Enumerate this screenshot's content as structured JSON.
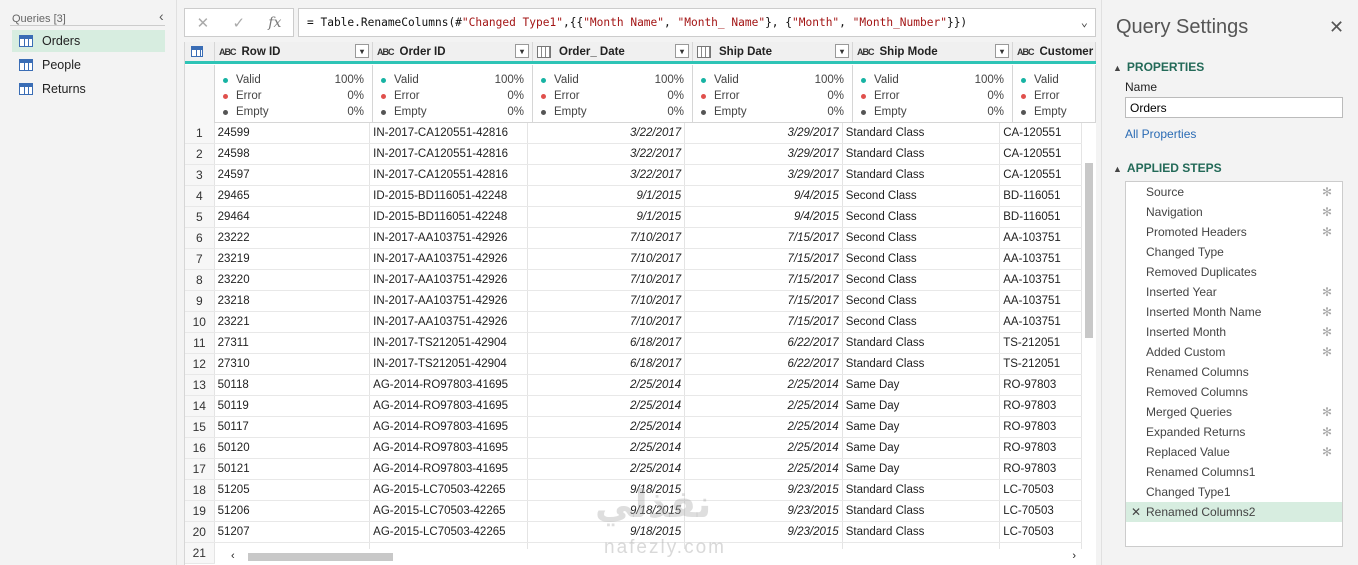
{
  "queries": {
    "header": "Queries [3]",
    "collapse_icon": "chevron-left-icon",
    "items": [
      {
        "label": "Orders",
        "selected": true
      },
      {
        "label": "People",
        "selected": false
      },
      {
        "label": "Returns",
        "selected": false
      }
    ]
  },
  "formula_bar": {
    "cancel_icon": "close-icon",
    "commit_icon": "check-icon",
    "fx_label": "fx",
    "formula": "= Table.RenameColumns(#\"Changed Type1\",{{\"Month Name\", \"Month_ Name\"}, {\"Month\", \"Month_Number\"}})",
    "formula_prefix": "= Table.RenameColumns(#",
    "formula_s1": "\"Changed Type1\"",
    "formula_p2": ",{{",
    "formula_s2": "\"Month Name\"",
    "formula_p3": ", ",
    "formula_s3": "\"Month_ Name\"",
    "formula_p4": "}, {",
    "formula_s4": "\"Month\"",
    "formula_p5": ", ",
    "formula_s5": "\"Month_Number\"",
    "formula_p6": "}})"
  },
  "grid": {
    "accent_color": "#2ec4b6",
    "columns": [
      {
        "name": "Row ID",
        "type": "text"
      },
      {
        "name": "Order ID",
        "type": "text"
      },
      {
        "name": "Order_ Date",
        "type": "date"
      },
      {
        "name": "Ship Date",
        "type": "date"
      },
      {
        "name": "Ship Mode",
        "type": "text"
      },
      {
        "name": "Customer ID",
        "type": "text"
      }
    ],
    "type_icon_text": "ABC",
    "quality_labels": {
      "valid": "Valid",
      "error": "Error",
      "empty": "Empty"
    },
    "quality": [
      {
        "valid": "100%",
        "error": "0%",
        "empty": "0%"
      },
      {
        "valid": "100%",
        "error": "0%",
        "empty": "0%"
      },
      {
        "valid": "100%",
        "error": "0%",
        "empty": "0%"
      },
      {
        "valid": "100%",
        "error": "0%",
        "empty": "0%"
      },
      {
        "valid": "100%",
        "error": "0%",
        "empty": "0%"
      },
      {
        "valid": "",
        "error": "",
        "empty": ""
      }
    ],
    "rows": [
      [
        "1",
        "24599",
        "IN-2017-CA120551-42816",
        "3/22/2017",
        "3/29/2017",
        "Standard Class",
        "CA-120551"
      ],
      [
        "2",
        "24598",
        "IN-2017-CA120551-42816",
        "3/22/2017",
        "3/29/2017",
        "Standard Class",
        "CA-120551"
      ],
      [
        "3",
        "24597",
        "IN-2017-CA120551-42816",
        "3/22/2017",
        "3/29/2017",
        "Standard Class",
        "CA-120551"
      ],
      [
        "4",
        "29465",
        "ID-2015-BD116051-42248",
        "9/1/2015",
        "9/4/2015",
        "Second Class",
        "BD-116051"
      ],
      [
        "5",
        "29464",
        "ID-2015-BD116051-42248",
        "9/1/2015",
        "9/4/2015",
        "Second Class",
        "BD-116051"
      ],
      [
        "6",
        "23222",
        "IN-2017-AA103751-42926",
        "7/10/2017",
        "7/15/2017",
        "Second Class",
        "AA-103751"
      ],
      [
        "7",
        "23219",
        "IN-2017-AA103751-42926",
        "7/10/2017",
        "7/15/2017",
        "Second Class",
        "AA-103751"
      ],
      [
        "8",
        "23220",
        "IN-2017-AA103751-42926",
        "7/10/2017",
        "7/15/2017",
        "Second Class",
        "AA-103751"
      ],
      [
        "9",
        "23218",
        "IN-2017-AA103751-42926",
        "7/10/2017",
        "7/15/2017",
        "Second Class",
        "AA-103751"
      ],
      [
        "10",
        "23221",
        "IN-2017-AA103751-42926",
        "7/10/2017",
        "7/15/2017",
        "Second Class",
        "AA-103751"
      ],
      [
        "11",
        "27311",
        "IN-2017-TS212051-42904",
        "6/18/2017",
        "6/22/2017",
        "Standard Class",
        "TS-212051"
      ],
      [
        "12",
        "27310",
        "IN-2017-TS212051-42904",
        "6/18/2017",
        "6/22/2017",
        "Standard Class",
        "TS-212051"
      ],
      [
        "13",
        "50118",
        "AG-2014-RO97803-41695",
        "2/25/2014",
        "2/25/2014",
        "Same Day",
        "RO-97803"
      ],
      [
        "14",
        "50119",
        "AG-2014-RO97803-41695",
        "2/25/2014",
        "2/25/2014",
        "Same Day",
        "RO-97803"
      ],
      [
        "15",
        "50117",
        "AG-2014-RO97803-41695",
        "2/25/2014",
        "2/25/2014",
        "Same Day",
        "RO-97803"
      ],
      [
        "16",
        "50120",
        "AG-2014-RO97803-41695",
        "2/25/2014",
        "2/25/2014",
        "Same Day",
        "RO-97803"
      ],
      [
        "17",
        "50121",
        "AG-2014-RO97803-41695",
        "2/25/2014",
        "2/25/2014",
        "Same Day",
        "RO-97803"
      ],
      [
        "18",
        "51205",
        "AG-2015-LC70503-42265",
        "9/18/2015",
        "9/23/2015",
        "Standard Class",
        "LC-70503"
      ],
      [
        "19",
        "51206",
        "AG-2015-LC70503-42265",
        "9/18/2015",
        "9/23/2015",
        "Standard Class",
        "LC-70503"
      ],
      [
        "20",
        "51207",
        "AG-2015-LC70503-42265",
        "9/18/2015",
        "9/23/2015",
        "Standard Class",
        "LC-70503"
      ],
      [
        "21",
        "",
        "",
        "",
        "",
        "",
        ""
      ]
    ]
  },
  "watermark": {
    "arabic": "نفذلي",
    "latin": "nafezly.com"
  },
  "settings": {
    "title": "Query Settings",
    "close_icon": "close-icon",
    "properties_header": "PROPERTIES",
    "name_label": "Name",
    "name_value": "Orders",
    "all_properties": "All Properties",
    "applied_steps_header": "APPLIED STEPS",
    "steps": [
      {
        "label": "Source",
        "gear": true
      },
      {
        "label": "Navigation",
        "gear": true
      },
      {
        "label": "Promoted Headers",
        "gear": true
      },
      {
        "label": "Changed Type",
        "gear": false
      },
      {
        "label": "Removed Duplicates",
        "gear": false
      },
      {
        "label": "Inserted Year",
        "gear": true
      },
      {
        "label": "Inserted Month Name",
        "gear": true
      },
      {
        "label": "Inserted Month",
        "gear": true
      },
      {
        "label": "Added Custom",
        "gear": true
      },
      {
        "label": "Renamed Columns",
        "gear": false
      },
      {
        "label": "Removed Columns",
        "gear": false
      },
      {
        "label": "Merged Queries",
        "gear": true
      },
      {
        "label": "Expanded Returns",
        "gear": true
      },
      {
        "label": "Replaced Value",
        "gear": true
      },
      {
        "label": "Renamed Columns1",
        "gear": false
      },
      {
        "label": "Changed Type1",
        "gear": false
      },
      {
        "label": "Renamed Columns2",
        "gear": false,
        "selected": true
      }
    ]
  }
}
